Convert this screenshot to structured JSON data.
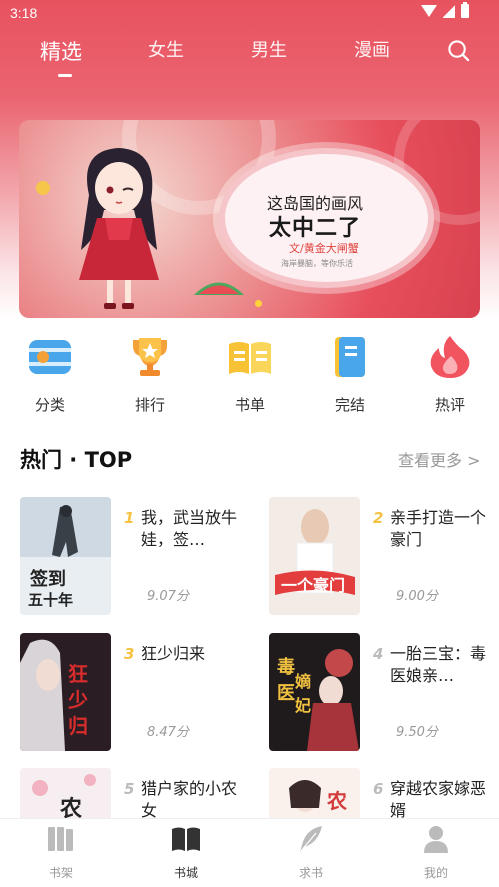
{
  "status": {
    "time": "3:18"
  },
  "tabs": [
    {
      "label": "精选",
      "active": true
    },
    {
      "label": "女生",
      "active": false
    },
    {
      "label": "男生",
      "active": false
    },
    {
      "label": "漫画",
      "active": false
    }
  ],
  "banner": {
    "title1": "这岛国的画风",
    "title2": "太中二了",
    "author": "文/黄金大闸蟹",
    "slogan": "海岸暴脑，等你乐活"
  },
  "categories": [
    {
      "label": "分类",
      "icon": "category-icon"
    },
    {
      "label": "排行",
      "icon": "trophy-icon"
    },
    {
      "label": "书单",
      "icon": "open-book-icon"
    },
    {
      "label": "完结",
      "icon": "finished-book-icon"
    },
    {
      "label": "热评",
      "icon": "flame-icon"
    }
  ],
  "section": {
    "title": "热门 · TOP",
    "more": "查看更多 >"
  },
  "books": [
    {
      "rank": "1",
      "title": "我，武当放牛娃，签…",
      "score": "9.07分",
      "cover_text": "签到五十年"
    },
    {
      "rank": "2",
      "title": "亲手打造一个豪门",
      "score": "9.00分",
      "cover_text": "一个豪门"
    },
    {
      "rank": "3",
      "title": "狂少归来",
      "score": "8.47分",
      "cover_text": "狂少归来"
    },
    {
      "rank": "4",
      "title": "一胎三宝：毒医娘亲…",
      "score": "9.50分",
      "cover_text": "毒医嫡妃"
    },
    {
      "rank": "5",
      "title": "猎户家的小农女",
      "score": "",
      "cover_text": ""
    },
    {
      "rank": "6",
      "title": "穿越农家嫁恶婿",
      "score": "",
      "cover_text": ""
    }
  ],
  "bottom_nav": [
    {
      "label": "书架",
      "active": false
    },
    {
      "label": "书城",
      "active": true
    },
    {
      "label": "求书",
      "active": false
    },
    {
      "label": "我的",
      "active": false
    }
  ],
  "colors": {
    "accent": "#e8525f",
    "rank_gold": "#f5c242",
    "rank_gray": "#bbbbbb"
  }
}
